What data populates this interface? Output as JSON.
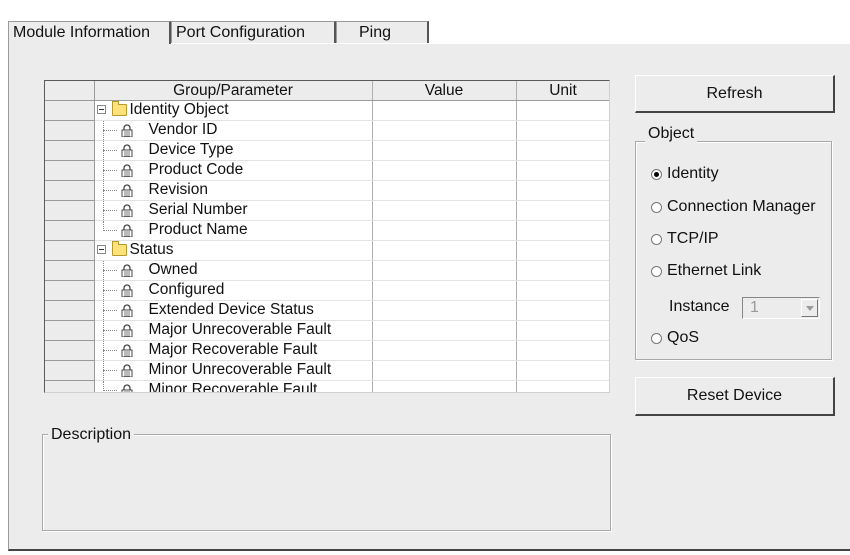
{
  "tabs": [
    {
      "label": "Module Information",
      "active": true
    },
    {
      "label": "Port Configuration",
      "active": false
    },
    {
      "label": "Ping",
      "active": false
    }
  ],
  "grid": {
    "columns": [
      "Group/Parameter",
      "Value",
      "Unit"
    ],
    "rows": [
      {
        "label": "Identity Object",
        "kind": "folder",
        "value": "",
        "unit": ""
      },
      {
        "label": "Vendor ID",
        "kind": "param",
        "value": "",
        "unit": ""
      },
      {
        "label": "Device Type",
        "kind": "param",
        "value": "",
        "unit": ""
      },
      {
        "label": "Product Code",
        "kind": "param",
        "value": "",
        "unit": ""
      },
      {
        "label": "Revision",
        "kind": "param",
        "value": "",
        "unit": ""
      },
      {
        "label": "Serial Number",
        "kind": "param",
        "value": "",
        "unit": ""
      },
      {
        "label": "Product Name",
        "kind": "param",
        "value": "",
        "unit": ""
      },
      {
        "label": "Status",
        "kind": "folder",
        "value": "",
        "unit": ""
      },
      {
        "label": "Owned",
        "kind": "param",
        "value": "",
        "unit": ""
      },
      {
        "label": "Configured",
        "kind": "param",
        "value": "",
        "unit": ""
      },
      {
        "label": "Extended Device Status",
        "kind": "param",
        "value": "",
        "unit": ""
      },
      {
        "label": "Major Unrecoverable Fault",
        "kind": "param",
        "value": "",
        "unit": ""
      },
      {
        "label": "Major Recoverable Fault",
        "kind": "param",
        "value": "",
        "unit": ""
      },
      {
        "label": "Minor Unrecoverable Fault",
        "kind": "param",
        "value": "",
        "unit": ""
      },
      {
        "label": "Minor Recoverable Fault",
        "kind": "param",
        "value": "",
        "unit": ""
      }
    ]
  },
  "buttons": {
    "refresh": "Refresh",
    "reset_device": "Reset Device"
  },
  "object_group": {
    "title": "Object",
    "options": [
      "Identity",
      "Connection Manager",
      "TCP/IP",
      "Ethernet Link",
      "QoS"
    ],
    "selected": "Identity",
    "instance_label": "Instance",
    "instance_value": "1"
  },
  "description": {
    "title": "Description"
  },
  "icons": {
    "folder": "folder-icon",
    "lock": "lock-icon",
    "expander": "collapse-icon",
    "radio": "radio-icon",
    "dropdown": "chevron-down-icon"
  },
  "colors": {
    "panel": "#ececec",
    "folder": "#ffe27a"
  }
}
